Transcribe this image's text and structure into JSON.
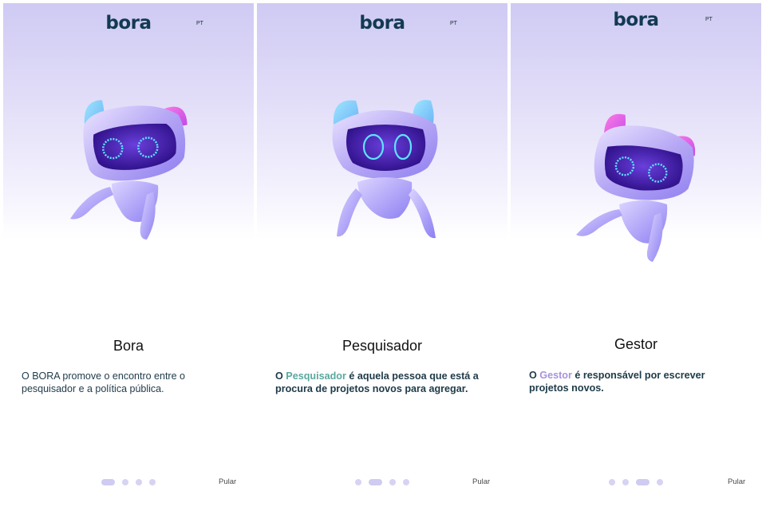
{
  "colors": {
    "brand_dark": "#123a52",
    "hero_top": "#cfcaf3",
    "accent_teal": "#5aa89e",
    "accent_purple": "#a792dc",
    "dot_inactive": "#d6d3f3",
    "dot_active": "#cfcbf1"
  },
  "screens": [
    {
      "logo": "bora",
      "lang": "PT",
      "robot_icon": "robot-mascot-icon",
      "title": "Bora",
      "description": "O BORA promove o encontro entre o pesquisador e a política pública.",
      "active_page": 1,
      "page_count": 4,
      "skip_label": "Pular"
    },
    {
      "logo": "bora",
      "lang": "PT",
      "robot_icon": "robot-mascot-icon",
      "title": "Pesquisador",
      "description_prefix": "O ",
      "description_highlight": "Pesquisador",
      "description_suffix": " é aquela pessoa que está a procura de projetos novos para agregar.",
      "active_page": 2,
      "page_count": 4,
      "skip_label": "Pular"
    },
    {
      "logo": "bora",
      "lang": "PT",
      "robot_icon": "robot-mascot-icon",
      "title": "Gestor",
      "description_prefix": "O ",
      "description_highlight": "Gestor",
      "description_suffix": " é responsável por escrever projetos novos.",
      "active_page": 3,
      "page_count": 4,
      "skip_label": "Pular"
    }
  ]
}
